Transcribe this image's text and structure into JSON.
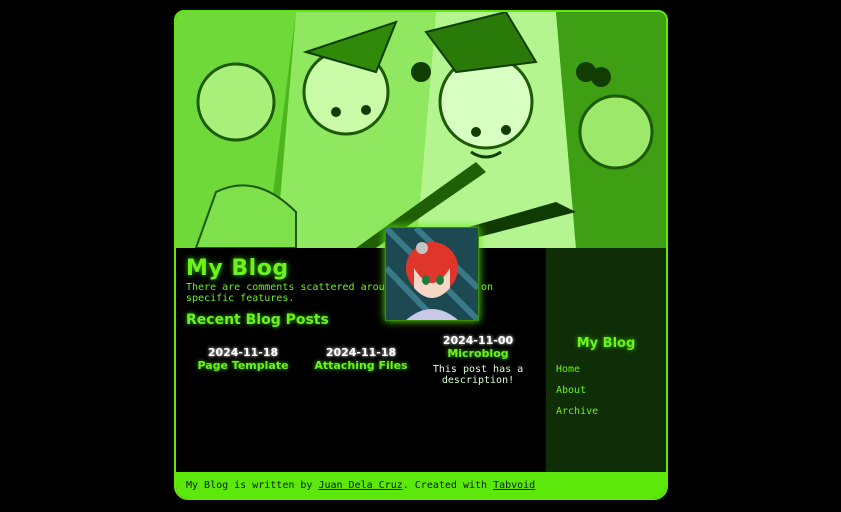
{
  "site": {
    "title": "My Blog",
    "intro": "There are comments scattered around to guide you on specific features.",
    "recent_heading": "Recent Blog Posts"
  },
  "posts": [
    {
      "date": "2024-11-18",
      "title": "Page Template",
      "description": ""
    },
    {
      "date": "2024-11-18",
      "title": "Attaching Files",
      "description": ""
    },
    {
      "date": "2024-11-00",
      "title": "Microblog",
      "description": "This post has a description!"
    }
  ],
  "sidebar": {
    "title": "My Blog",
    "nav": [
      {
        "label": "Home"
      },
      {
        "label": "About"
      },
      {
        "label": "Archive"
      }
    ]
  },
  "footer": {
    "prefix": "My Blog is written by ",
    "author": "Juan Dela Cruz",
    "middle": ". Created with ",
    "tool": "Tabvoid"
  },
  "colors": {
    "accent": "#6cf21c",
    "footer_bg": "#5de80c",
    "sidebar_bg": "#0f2d06",
    "background": "#000000"
  }
}
